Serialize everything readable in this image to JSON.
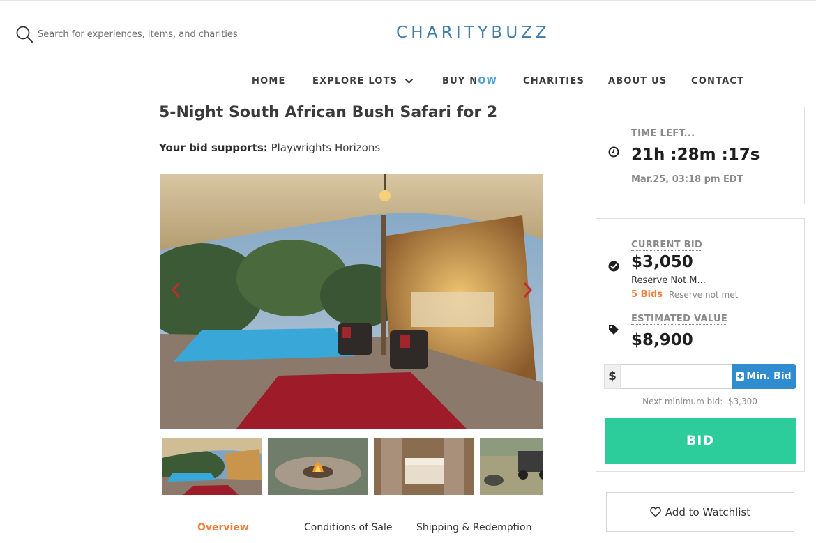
{
  "header": {
    "search_placeholder": "Search for experiences, items, and charities",
    "logo_text": "CHARITYBUZZ",
    "brand_color": "#3f7ca8"
  },
  "nav": {
    "home": "HOME",
    "explore_lots": "EXPLORE LOTS",
    "buy_now_part1": "BUY N",
    "buy_now_part2": "OW",
    "charities": "CHARITIES",
    "about_us": "ABOUT US",
    "contact": "CONTACT"
  },
  "lot": {
    "title": "5-Night South African Bush Safari for 2",
    "supports_label": "Your bid supports:",
    "charity": "Playwrights Horizons"
  },
  "gallery": {
    "thumbnail_count": 4
  },
  "tabs": {
    "overview": "Overview",
    "conditions": "Conditions of Sale",
    "shipping": "Shipping & Redemption"
  },
  "timer": {
    "label": "TIME LEFT...",
    "countdown": "21h :28m :17s",
    "end_date": "Mar.25, 03:18 pm EDT"
  },
  "bidding": {
    "current_bid_label": "CURRENT BID",
    "current_bid": "$3,050",
    "reserve_short": "Reserve Not M...",
    "bid_count": "5 Bids",
    "reserve_status": "Reserve not met",
    "estimated_value_label": "ESTIMATED VALUE",
    "estimated_value": "$8,900",
    "currency_symbol": "$",
    "bid_input_value": "",
    "min_bid_label": "Min. Bid",
    "next_min_label": "Next minimum bid:",
    "next_min_value": "$3,300",
    "bid_button": "BID",
    "watchlist": "Add to Watchlist",
    "bid_color": "#2dcc9b",
    "accent_color": "#f0803c"
  },
  "icons": {
    "search": "search-icon",
    "chevron": "chevron-down-icon",
    "clock": "clock-icon",
    "check": "check-circle-icon",
    "tag": "tag-icon",
    "plus": "plus-square-icon",
    "heart": "heart-outline-icon"
  }
}
